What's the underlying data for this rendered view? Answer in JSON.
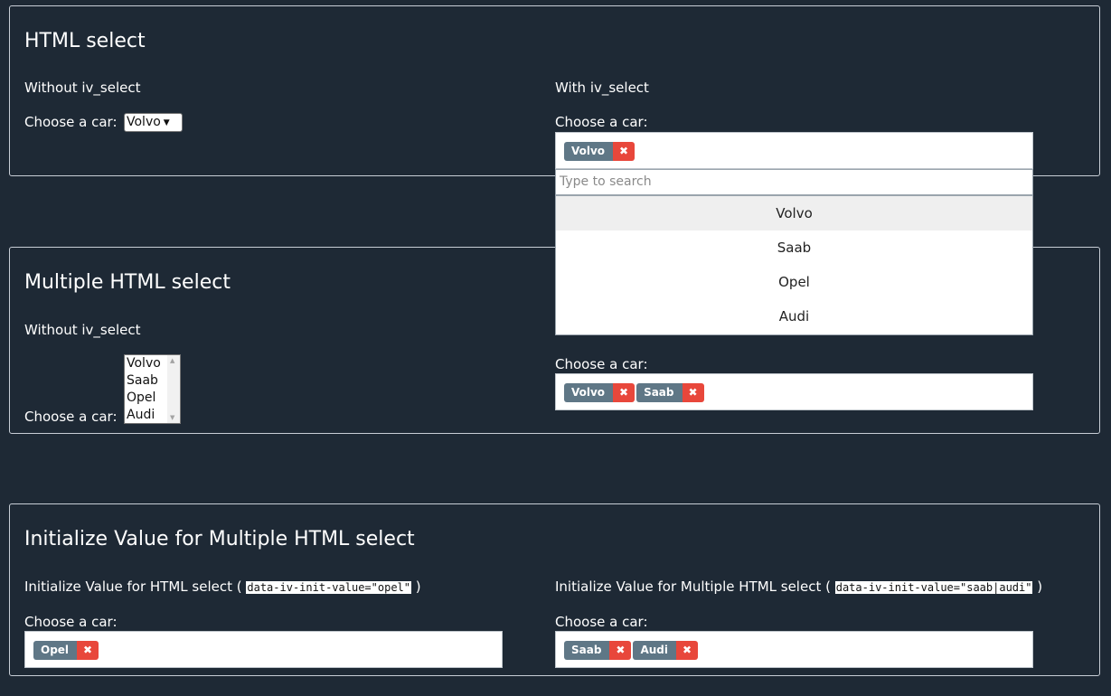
{
  "panel1": {
    "title": "HTML select",
    "left_sub": "Without iv_select",
    "right_sub": "With iv_select",
    "left_label": "Choose a car:",
    "right_label": "Choose a car:",
    "native_value": "Volvo",
    "chips": [
      "Volvo"
    ],
    "search_placeholder": "Type to search",
    "options": [
      "Volvo",
      "Saab",
      "Opel",
      "Audi"
    ],
    "highlighted_option": "Volvo"
  },
  "panel2": {
    "title": "Multiple HTML select",
    "left_sub": "Without iv_select",
    "left_label": "Choose a car:",
    "right_label": "Choose a car:",
    "native_options": [
      "Volvo",
      "Saab",
      "Opel",
      "Audi"
    ],
    "chips": [
      "Volvo",
      "Saab"
    ]
  },
  "panel3": {
    "title": "Initialize Value for Multiple HTML select",
    "left_sub_prefix": "Initialize Value for HTML select (",
    "left_code": "data-iv-init-value=\"opel\"",
    "left_sub_suffix": ")",
    "right_sub_prefix": "Initialize Value for Multiple HTML select (",
    "right_code": "data-iv-init-value=\"saab|audi\"",
    "right_sub_suffix": ")",
    "left_label": "Choose a car:",
    "right_label": "Choose a car:",
    "left_chips": [
      "Opel"
    ],
    "right_chips": [
      "Saab",
      "Audi"
    ]
  },
  "chip_remove_glyph": "✖",
  "colors": {
    "background": "#1e2935",
    "chip": "#5f7786",
    "chip_remove": "#e8473b"
  }
}
